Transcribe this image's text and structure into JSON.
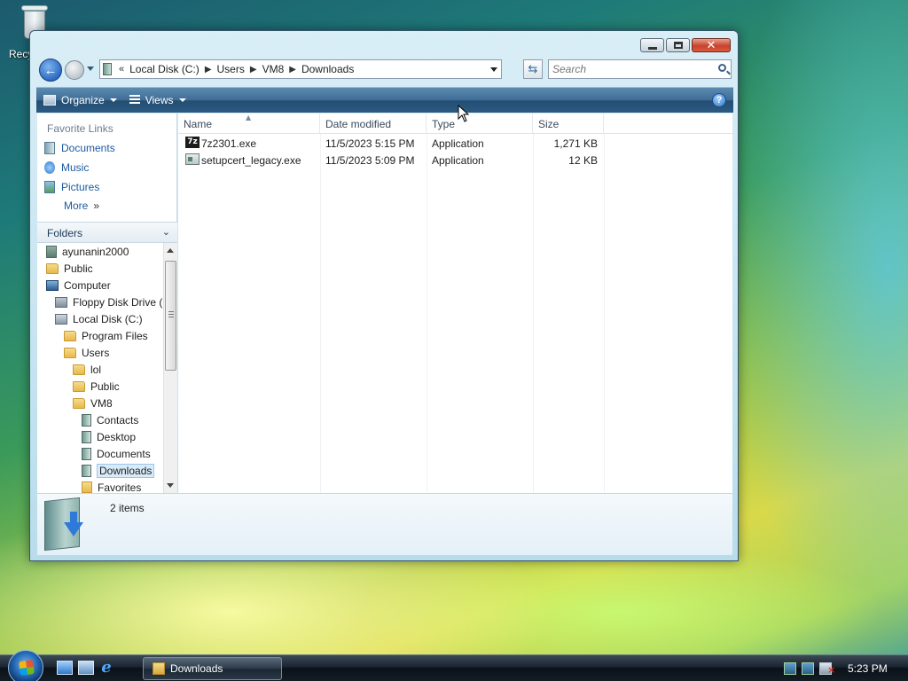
{
  "desktop": {
    "recycle_label": "Recy"
  },
  "window": {
    "buttons": {
      "minimize": "minimize",
      "maximize": "maximize",
      "close": "close"
    }
  },
  "nav": {
    "breadcrumb_lead": "«",
    "breadcrumbs": [
      "Local Disk (C:)",
      "Users",
      "VM8",
      "Downloads"
    ],
    "search_placeholder": "Search"
  },
  "toolbar": {
    "organize": "Organize",
    "views": "Views",
    "help": "?"
  },
  "favorites": {
    "header": "Favorite Links",
    "items": [
      "Documents",
      "Music",
      "Pictures"
    ],
    "more": "More"
  },
  "folders": {
    "header": "Folders",
    "tree": [
      {
        "label": "ayunanin2000",
        "icon": "user-icon",
        "level": 0
      },
      {
        "label": "Public",
        "icon": "folder-icon",
        "level": 0
      },
      {
        "label": "Computer",
        "icon": "computer-icon",
        "level": 0
      },
      {
        "label": "Floppy Disk Drive (",
        "icon": "floppy-icon",
        "level": 1
      },
      {
        "label": "Local Disk (C:)",
        "icon": "disk-icon",
        "level": 1
      },
      {
        "label": "Program Files",
        "icon": "folder-icon",
        "level": 2
      },
      {
        "label": "Users",
        "icon": "folder-icon",
        "level": 2
      },
      {
        "label": "lol",
        "icon": "folder-icon",
        "level": 3
      },
      {
        "label": "Public",
        "icon": "folder-icon",
        "level": 3
      },
      {
        "label": "VM8",
        "icon": "folder-icon",
        "level": 3
      },
      {
        "label": "Contacts",
        "icon": "special-folder-icon",
        "level": 4
      },
      {
        "label": "Desktop",
        "icon": "special-folder-icon",
        "level": 4
      },
      {
        "label": "Documents",
        "icon": "special-folder-icon",
        "level": 4
      },
      {
        "label": "Downloads",
        "icon": "special-folder-icon",
        "level": 4,
        "selected": true
      },
      {
        "label": "Favorites",
        "icon": "favorites-folder-icon",
        "level": 4
      }
    ]
  },
  "columns": {
    "name": "Name",
    "date": "Date modified",
    "type": "Type",
    "size": "Size"
  },
  "files": [
    {
      "name": "7z2301.exe",
      "date": "11/5/2023 5:15 PM",
      "type": "Application",
      "size": "1,271 KB",
      "icon": "7z",
      "icon_text": "7z"
    },
    {
      "name": "setupcert_legacy.exe",
      "date": "11/5/2023 5:09 PM",
      "type": "Application",
      "size": "12 KB",
      "icon": "exe"
    }
  ],
  "details": {
    "count": "2 items"
  },
  "taskbar": {
    "task_label": "Downloads",
    "clock": "5:23 PM"
  }
}
